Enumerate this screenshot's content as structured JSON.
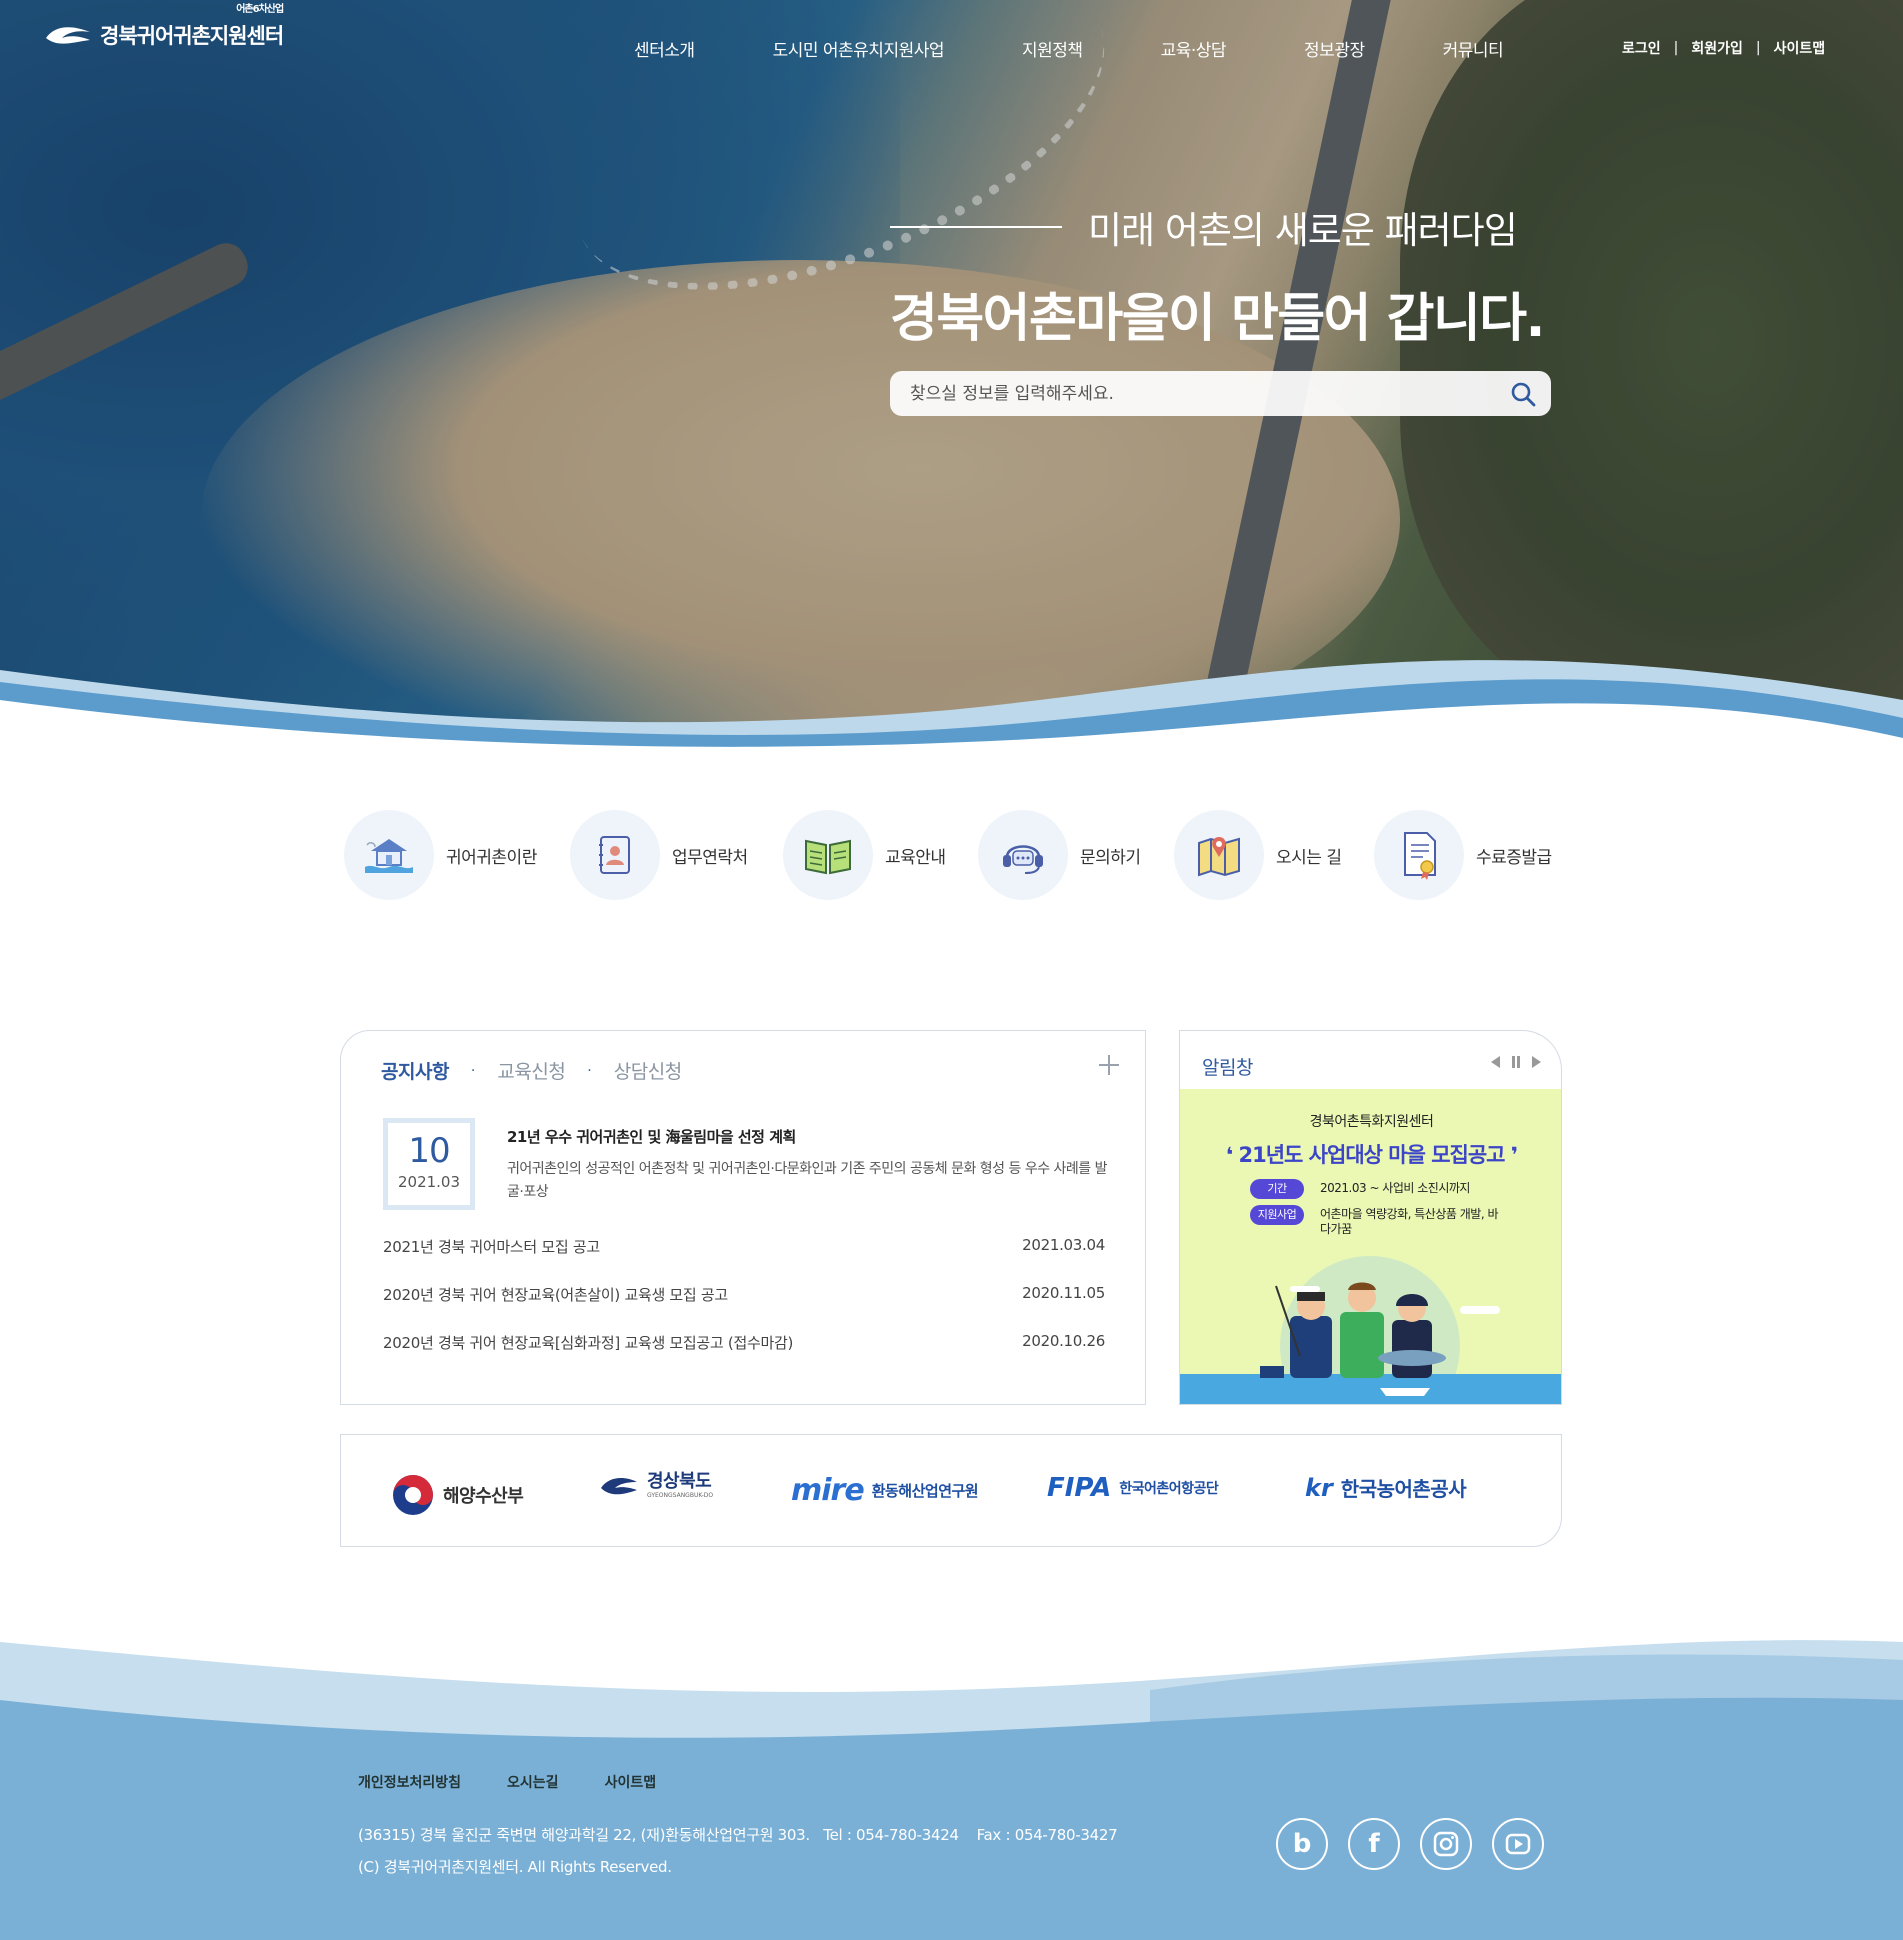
{
  "header": {
    "logo_text": "경북귀어귀촌지원센터",
    "logo_super": "어촌6차산업",
    "nav": [
      "센터소개",
      "도시민 어촌유치지원사업",
      "지원정책",
      "교육·상담",
      "정보광장",
      "커뮤니티"
    ],
    "util": {
      "login": "로그인",
      "join": "회원가입",
      "sitemap": "사이트맵",
      "separator": "|"
    }
  },
  "hero": {
    "subtitle": "미래 어촌의 새로운 패러다임",
    "title": "경북어촌마을이 만들어 갑니다.",
    "search_placeholder": "찾으실 정보를 입력해주세요."
  },
  "quick_menu": [
    {
      "label": "귀어귀촌이란",
      "icon": "house-on-water-icon"
    },
    {
      "label": "업무연락처",
      "icon": "contact-book-icon"
    },
    {
      "label": "교육안내",
      "icon": "open-book-icon"
    },
    {
      "label": "문의하기",
      "icon": "headset-chat-icon"
    },
    {
      "label": "오시는 길",
      "icon": "map-pin-icon"
    },
    {
      "label": "수료증발급",
      "icon": "certificate-icon"
    }
  ],
  "notice": {
    "tabs": [
      "공지사항",
      "교육신청",
      "상담신청"
    ],
    "tab_separator": "·",
    "featured": {
      "day": "10",
      "month": "2021.03",
      "title": "21년 우수 귀어귀촌인 및 海울림마을 선정 계획",
      "desc": "귀어귀촌인의 성공적인 어촌정착 및 귀어귀촌인·다문화인과 기존 주민의 공동체 문화 형성 등 우수 사례를 발굴·포상"
    },
    "items": [
      {
        "title": "2021년 경북 귀어마스터 모집 공고",
        "date": "2021.03.04"
      },
      {
        "title": "2020년 경북 귀어 현장교육(어촌살이) 교육생 모집 공고",
        "date": "2020.11.05"
      },
      {
        "title": "2020년 경북 귀어 현장교육[심화과정] 교육생 모집공고 (접수마감)",
        "date": "2020.10.26"
      }
    ]
  },
  "popup": {
    "title": "알림창",
    "org": "경북어촌특화지원센터",
    "headline": "21년도 사업대상 마을 모집공고",
    "quote_open": "❛",
    "quote_close": "❜",
    "rows": [
      {
        "label": "기간",
        "value": "2021.03 ~ 사업비 소진시까지"
      },
      {
        "label": "지원사업",
        "value": "어촌마을 역량강화, 특산상품 개발, 바다가꿈"
      }
    ]
  },
  "partners": [
    {
      "name": "해양수산부",
      "color": "#333333"
    },
    {
      "name": "경상북도",
      "sub": "GYEONGSANGBUK-DO",
      "color": "#1e3a7a"
    },
    {
      "name": "환동해산업연구원",
      "mark": "mire",
      "color": "#1f4fa3"
    },
    {
      "name": "한국어촌어항공단",
      "mark": "FIPA",
      "color": "#1f4fa3"
    },
    {
      "name": "한국농어촌공사",
      "mark": "kr",
      "color": "#1f4fa3"
    }
  ],
  "footer": {
    "links": [
      "개인정보처리방침",
      "오시는길",
      "사이트맵"
    ],
    "address": "(36315) 경북 울진군 죽변면 해양과학길 22, (재)환동해산업연구원 303.   Tel : 054-780-3424    Fax : 054-780-3427",
    "copyright": "(C) 경북귀어귀촌지원센터. All Rights Reserved.",
    "social": [
      {
        "name": "blog",
        "glyph": "b"
      },
      {
        "name": "facebook",
        "glyph": "f"
      },
      {
        "name": "instagram",
        "glyph": ""
      },
      {
        "name": "youtube",
        "glyph": ""
      }
    ]
  },
  "colors": {
    "accent": "#2f5aa0",
    "footer_bg": "#7bb0d6",
    "wave_light": "#bcd8ea",
    "wave_mid": "#8dbbdc",
    "popup_bg": "#eaf8b4",
    "popup_accent": "#3c44c8"
  }
}
